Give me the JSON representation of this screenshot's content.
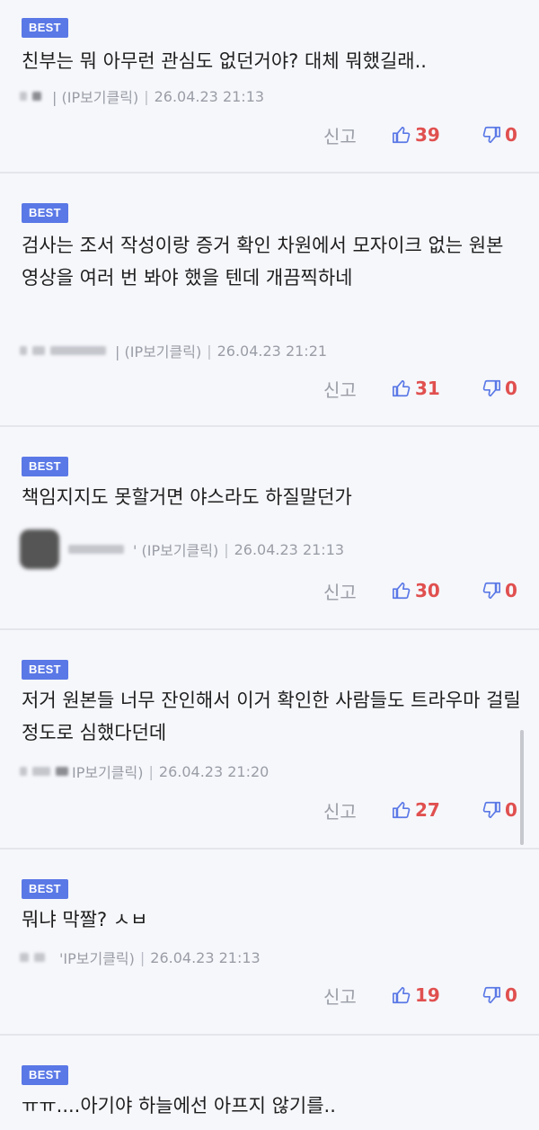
{
  "badge_label": "BEST",
  "report_label": "신고",
  "comments": [
    {
      "text": "친부는 뭐 아무런 관심도 없던거야? 대체 뭐했길래..",
      "meta_ip": "| (IP보기클릭)",
      "meta_date": "26.04.23 21:13",
      "likes": "39",
      "dislikes": "0"
    },
    {
      "text": "검사는 조서 작성이랑 증거 확인 차원에서 모자이크 없는 원본 영상을 여러 번 봐야 했을 텐데 개끔찍하네",
      "meta_ip": "| (IP보기클릭)",
      "meta_date": "26.04.23 21:21",
      "likes": "31",
      "dislikes": "0"
    },
    {
      "text": "책임지지도 못할거면 야스라도 하질말던가",
      "meta_ip": "' (IP보기클릭)",
      "meta_date": "26.04.23 21:13",
      "likes": "30",
      "dislikes": "0"
    },
    {
      "text": "저거 원본들 너무 잔인해서 이거 확인한 사람들도 트라우마 걸릴정도로 심했다던데",
      "meta_ip": "IP보기클릭)",
      "meta_date": "26.04.23 21:20",
      "likes": "27",
      "dislikes": "0"
    },
    {
      "text": "뭐냐 막짤? ㅅㅂ",
      "meta_ip": "'IP보기클릭)",
      "meta_date": "26.04.23 21:13",
      "likes": "19",
      "dislikes": "0"
    },
    {
      "text": "ㅠㅠ....아기야 하늘에선 아프지 않기를..",
      "meta_ip": "",
      "meta_date": "",
      "likes": "",
      "dislikes": ""
    }
  ],
  "colors": {
    "badge": "#5a78e6",
    "like": "#e0504f",
    "thumb_icon": "#5a78e6"
  },
  "icons": {
    "like": "thumbs-up-icon",
    "dislike": "thumbs-down-icon"
  }
}
